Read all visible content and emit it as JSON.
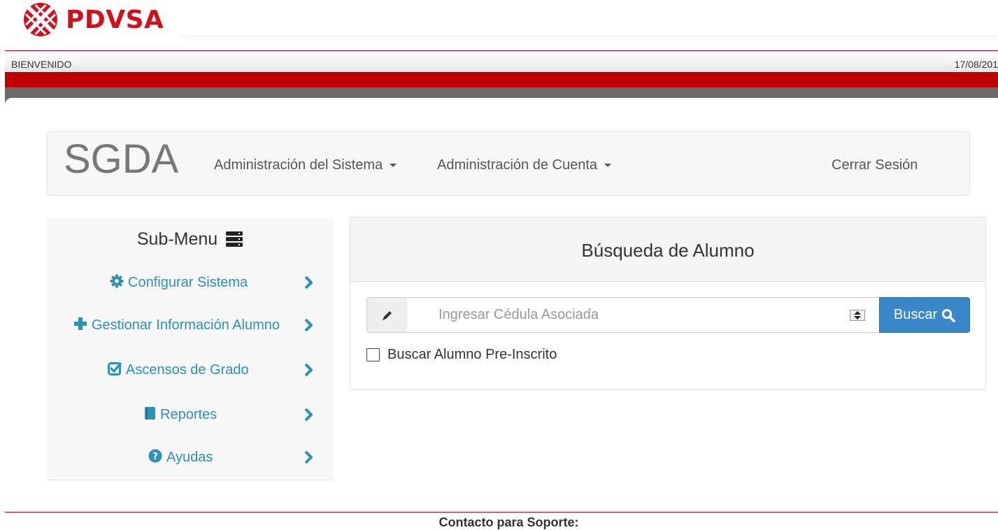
{
  "header": {
    "logo_text": "PDVSA",
    "welcome": "BIENVENIDO",
    "date": "17/08/201"
  },
  "navbar": {
    "brand": "SGDA",
    "items": [
      {
        "label": "Administración del Sistema"
      },
      {
        "label": "Administración de Cuenta"
      }
    ],
    "logout": "Cerrar Sesión"
  },
  "submenu": {
    "title": "Sub-Menu",
    "items": [
      {
        "label": "Configurar Sistema",
        "icon": "gear-icon"
      },
      {
        "label": "Gestionar Información Alumno",
        "icon": "plus-icon"
      },
      {
        "label": "Ascensos de Grado",
        "icon": "check-square-icon"
      },
      {
        "label": "Reportes",
        "icon": "book-icon"
      },
      {
        "label": "Ayudas",
        "icon": "question-circle-icon"
      }
    ]
  },
  "search": {
    "title": "Búsqueda de Alumno",
    "placeholder": "Ingresar Cédula Asociada",
    "value": "",
    "button": "Buscar",
    "checkbox_label": "Buscar Alumno Pre-Inscrito",
    "checkbox_checked": false
  },
  "footer": {
    "text": "Contacto para Soporte:"
  },
  "colors": {
    "brand_red": "#bf0000",
    "link_blue": "#2e8fb7",
    "button_blue": "#3a87c9"
  }
}
